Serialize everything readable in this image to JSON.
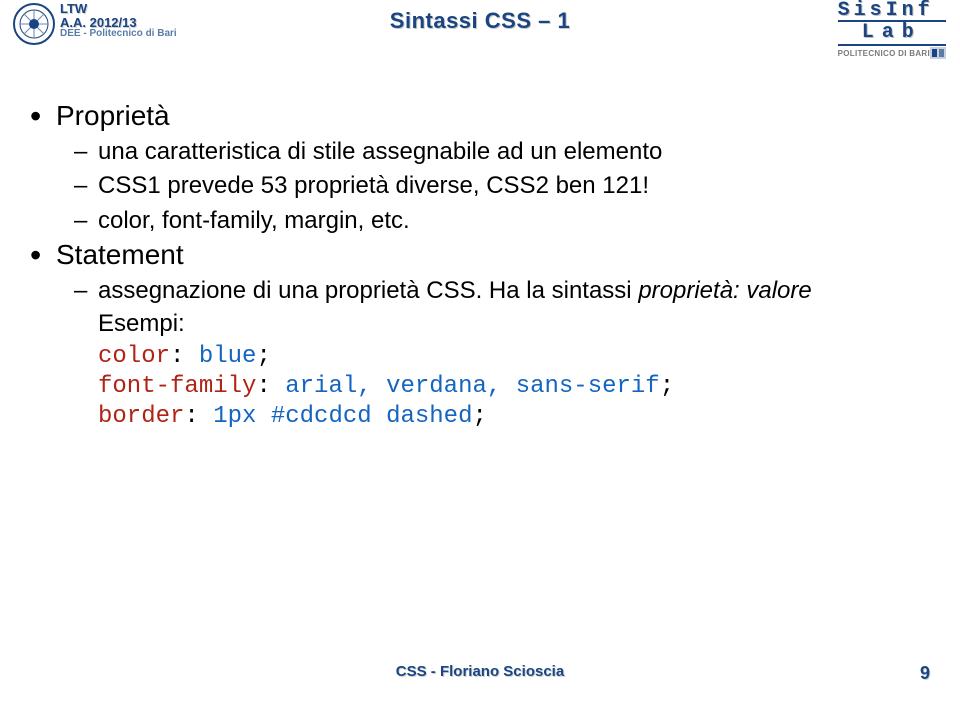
{
  "header": {
    "ltw": "LTW",
    "aa": "A.A. 2012/13",
    "dee": "DEE - Politecnico di Bari",
    "title": "Sintassi CSS – 1",
    "sisinf": "SisInf",
    "lab": "Lab",
    "poli": "POLITECNICO DI BARI"
  },
  "content": {
    "b1a": "Proprietà",
    "b2a": "una caratteristica di stile assegnabile ad un elemento",
    "b2b": "CSS1 prevede 53 proprietà diverse, CSS2 ben 121!",
    "b2c": "color, font-family, margin, etc.",
    "b1b": "Statement",
    "b2d_pre": "assegnazione di una proprietà CSS. Ha la sintassi ",
    "b2d_em": "proprietà: valore",
    "b2e": "Esempi:",
    "code": {
      "l1_prop": "color",
      "l1_val": "blue",
      "l2_prop": "font-family",
      "l2_val": "arial, verdana, sans-serif",
      "l3_prop": "border",
      "l3_val": "1px #cdcdcd dashed",
      "colon_sp": ": ",
      "semi": ";"
    }
  },
  "footer": {
    "text": "CSS - Floriano Scioscia",
    "page": "9"
  }
}
